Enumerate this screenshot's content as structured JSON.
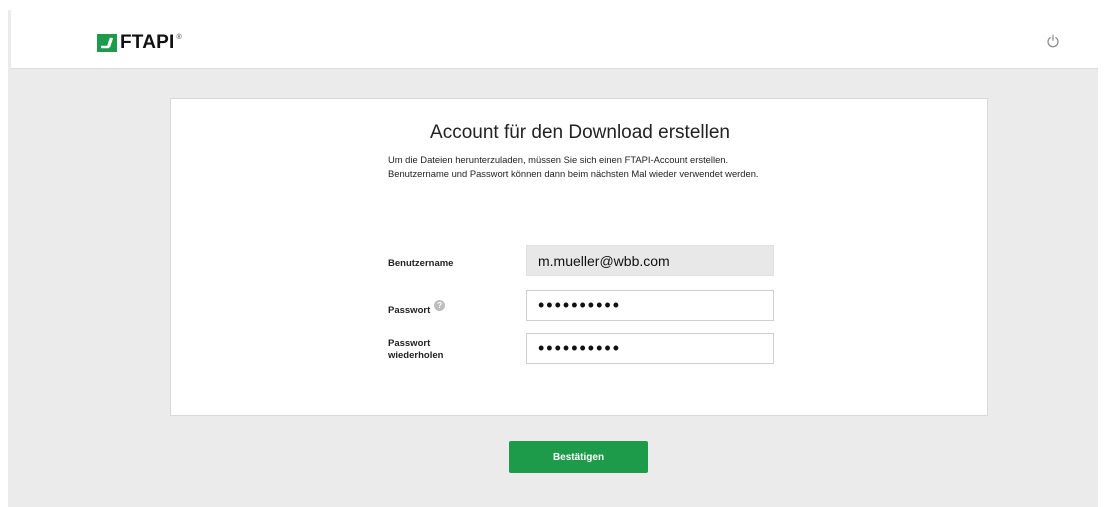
{
  "header": {
    "logo_text": "FTAPI",
    "logo_reg": "®",
    "power_icon": "power-icon",
    "accent_color": "#1e9a4b"
  },
  "form": {
    "title": "Account für den Download erstellen",
    "description": "Um die Dateien herunterzuladen, müssen Sie sich einen FTAPI-Account erstellen. Benutzername und Passwort können dann beim nächsten Mal wieder verwendet werden.",
    "username_label": "Benutzername",
    "username_value": "m.mueller@wbb.com",
    "password_label": "Passwort",
    "password_help_icon": "help-icon",
    "password_value": "••••••••••",
    "password_repeat_label_line1": "Passwort",
    "password_repeat_label_line2": "wiederholen",
    "password_repeat_value": "••••••••••"
  },
  "actions": {
    "submit_label": "Bestätigen"
  }
}
